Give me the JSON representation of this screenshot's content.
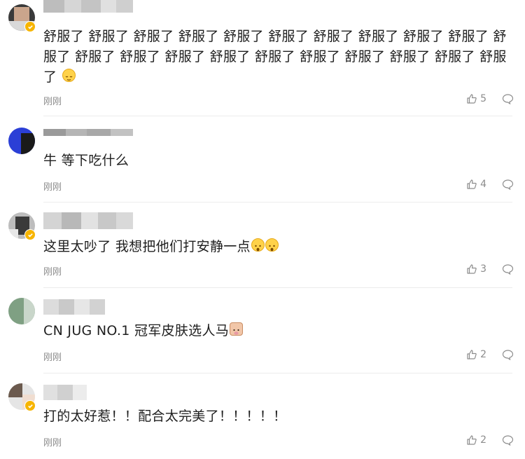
{
  "comments": [
    {
      "content": "舒服了 舒服了 舒服了 舒服了 舒服了 舒服了 舒服了 舒服了 舒服了 舒服了 舒服了 舒服了 舒服了 舒服了 舒服了 舒服了 舒服了 舒服了 舒服了 舒服了 舒服了",
      "time": "刚刚",
      "likes": "5",
      "verified": true,
      "emoji": "relieved-face"
    },
    {
      "content": "牛 等下吃什么",
      "time": "刚刚",
      "likes": "4",
      "verified": false
    },
    {
      "content": "这里太吵了 我想把他们打安静一点",
      "time": "刚刚",
      "likes": "3",
      "verified": true,
      "emoji": "fearful-face"
    },
    {
      "content": "CN JUG NO.1 冠军皮肤选人马",
      "time": "刚刚",
      "likes": "2",
      "verified": false,
      "emoji": "cow-face"
    },
    {
      "content": "打的太好惹！！配合太完美了！！！！！",
      "time": "刚刚",
      "likes": "2",
      "verified": true
    }
  ],
  "colors": {
    "text": "#1f1f1f",
    "meta": "#8c8c8c",
    "divider": "#ececec",
    "verified_badge": "#f7b500",
    "emoji": "#ffd24a"
  },
  "icons": [
    "like-icon",
    "comment-icon",
    "verified-badge-icon",
    "emoji-icon"
  ]
}
